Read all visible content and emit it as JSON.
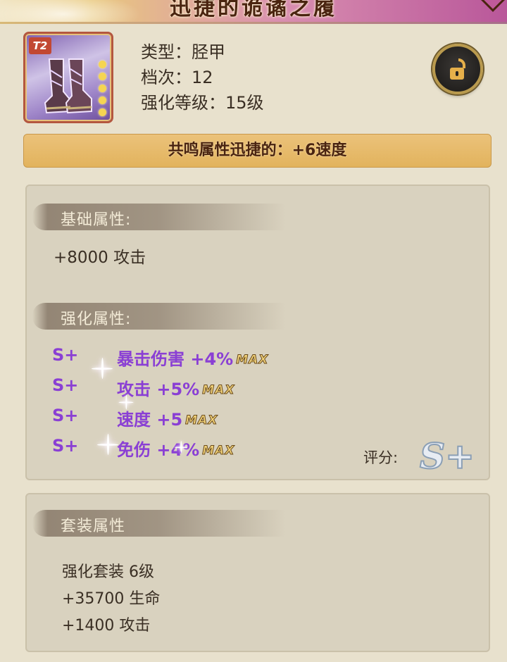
{
  "title": "迅捷的诡谲之履",
  "item": {
    "tier": "T2",
    "type_label": "类型：",
    "type_value": "胫甲",
    "grade_label": "档次：",
    "grade_value": "12",
    "enhance_label": "强化等级：",
    "enhance_value": "15级"
  },
  "resonance": "共鸣属性迅捷的：+6速度",
  "base": {
    "header": "基础属性:",
    "line": "+8000 攻击"
  },
  "enhance": {
    "header": "强化属性:",
    "max_label": "MAX",
    "rows": [
      {
        "grade": "S+",
        "stat": "暴击伤害 +4%"
      },
      {
        "grade": "S+",
        "stat": "攻击 +5%"
      },
      {
        "grade": "S+",
        "stat": "速度 +5"
      },
      {
        "grade": "S+",
        "stat": "免伤 +4%"
      }
    ]
  },
  "score": {
    "label": "评分:",
    "value": "S+"
  },
  "set": {
    "header": "套装属性",
    "lines": [
      "强化套装 6级",
      "+35700 生命",
      "+1400 攻击"
    ]
  },
  "colors": {
    "grade_purple": "#8a3fd4",
    "resonance_gold": "#e2b35d",
    "icon_border": "#b4573f"
  },
  "icons": {
    "lock": "unlock-icon"
  }
}
